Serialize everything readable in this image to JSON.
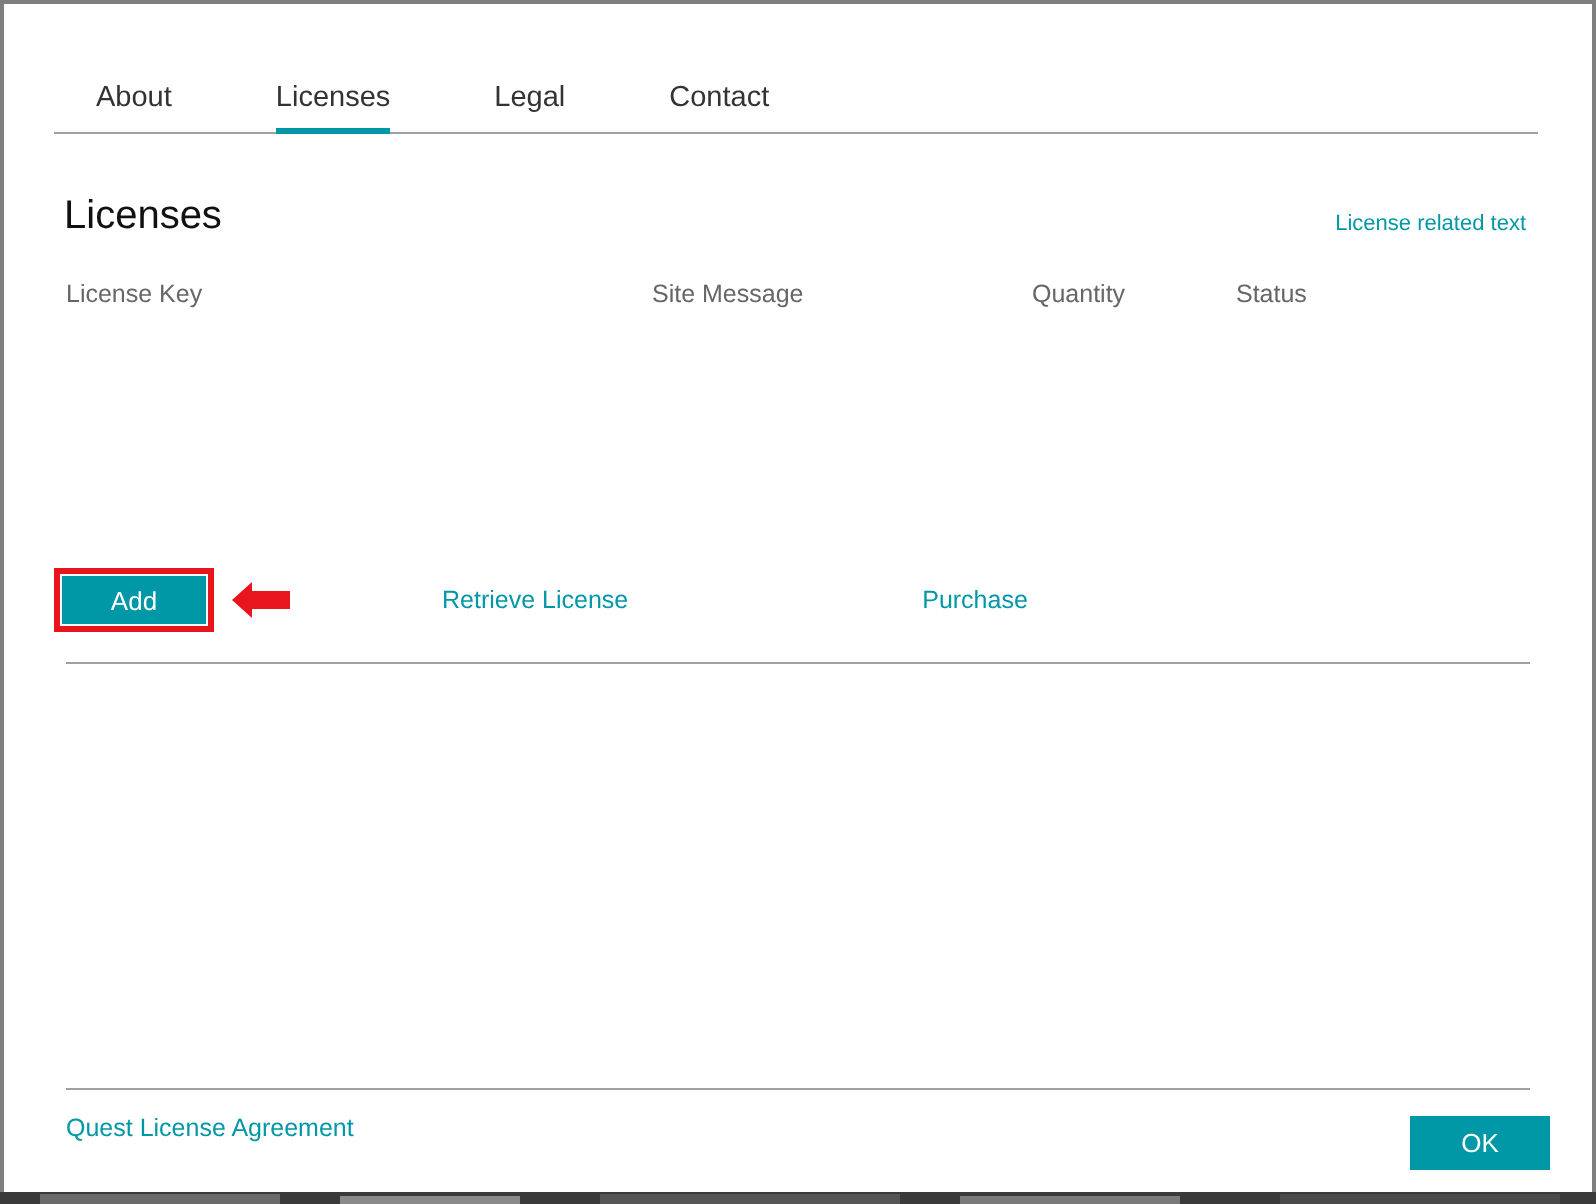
{
  "tabs": [
    {
      "label": "About",
      "selected": false
    },
    {
      "label": "Licenses",
      "selected": true
    },
    {
      "label": "Legal",
      "selected": false
    },
    {
      "label": "Contact",
      "selected": false
    }
  ],
  "section": {
    "title": "Licenses",
    "related_link": "License related text"
  },
  "table": {
    "columns": [
      "License Key",
      "Site Message",
      "Quantity",
      "Status"
    ]
  },
  "actions": {
    "add": {
      "label": "Add",
      "highlighted": true
    },
    "links": [
      "Retrieve License",
      "Purchase"
    ]
  },
  "footer": {
    "link": "Quest License Agreement",
    "ok": "OK"
  }
}
